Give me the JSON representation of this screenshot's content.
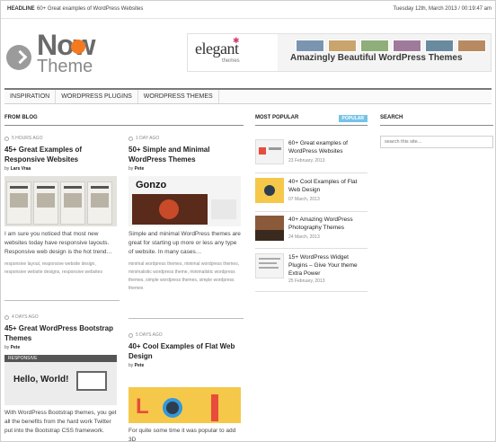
{
  "topbar": {
    "headline_label": "HEADLINE",
    "headline_text": "60+ Great examples of WordPress Websites",
    "datetime": "Tuesday 12th, March 2013 / 00:19:47 am"
  },
  "logo": {
    "line1": "Now",
    "line2": "Theme"
  },
  "banner": {
    "brand": "elegant",
    "brand_sub": "themes",
    "tagline": "Amazingly Beautiful WordPress Themes"
  },
  "nav": {
    "items": [
      {
        "label": "Inspiration"
      },
      {
        "label": "WordPress Plugins"
      },
      {
        "label": "WordPress Themes"
      }
    ]
  },
  "columns": {
    "from_blog": "FROM BLOG",
    "most_popular": "MOST POPULAR",
    "popular_badge": "POPULAR",
    "search": "SEARCH"
  },
  "blog": {
    "posts": [
      {
        "time": "5 HOURS AGO",
        "title": "45+ Great Examples of Responsive Websites",
        "by_label": "by",
        "author": "Lars Vraa",
        "text": "I am sure you noticed that most new websites today have responsive layouts. Responsive web design is the hot trend…",
        "tags": "responsive layout, responsive website design, responsive website designs, responsive websites"
      },
      {
        "time": "1 DAY AGO",
        "title": "50+ Simple and Minimal WordPress Themes",
        "by_label": "by",
        "author": "Pete",
        "thumb_title": "Gonzo",
        "text": "Simple and minimal WordPress themes are great for starting up more or less any type of website. In many cases…",
        "tags": "minimal wordpress themes, minimal wordpress themes, minimalistic wordpress theme, minimalistic wordpress themes, simple wordpress themes, simple wordpress themes"
      },
      {
        "time": "4 DAYS AGO",
        "title": "45+ Great WordPress Bootstrap Themes",
        "by_label": "by",
        "author": "Pete",
        "thumb_title": "RESPONSIVE",
        "thumb_hello": "Hello, World!",
        "text": "With WordPress Bootstrap themes, you get all the benefits from the hard work Twitter put into the Bootstrap CSS framework."
      },
      {
        "time": "5 DAYS AGO",
        "title": "40+ Cool Examples of Flat Web Design",
        "by_label": "by",
        "author": "Pete",
        "text": "For quite some time it was popular to add 3D"
      }
    ]
  },
  "popular": {
    "items": [
      {
        "title": "60+ Great examples of WordPress Websites",
        "date": "23 February, 2013"
      },
      {
        "title": "40+ Cool Examples of Flat Web Design",
        "date": "07 March, 2013"
      },
      {
        "title": "40+ Amazing WordPress Photography Themes",
        "date": "24 March, 2013"
      },
      {
        "title": "15+ WordPress Widget Plugins – Give Your theme Extra Power",
        "date": "25 February, 2013"
      }
    ]
  },
  "search": {
    "placeholder": "search this site..."
  },
  "colors": {
    "accent": "#f47a20",
    "badge": "#74c4e8",
    "logo_gray": "#6a6a6a"
  }
}
